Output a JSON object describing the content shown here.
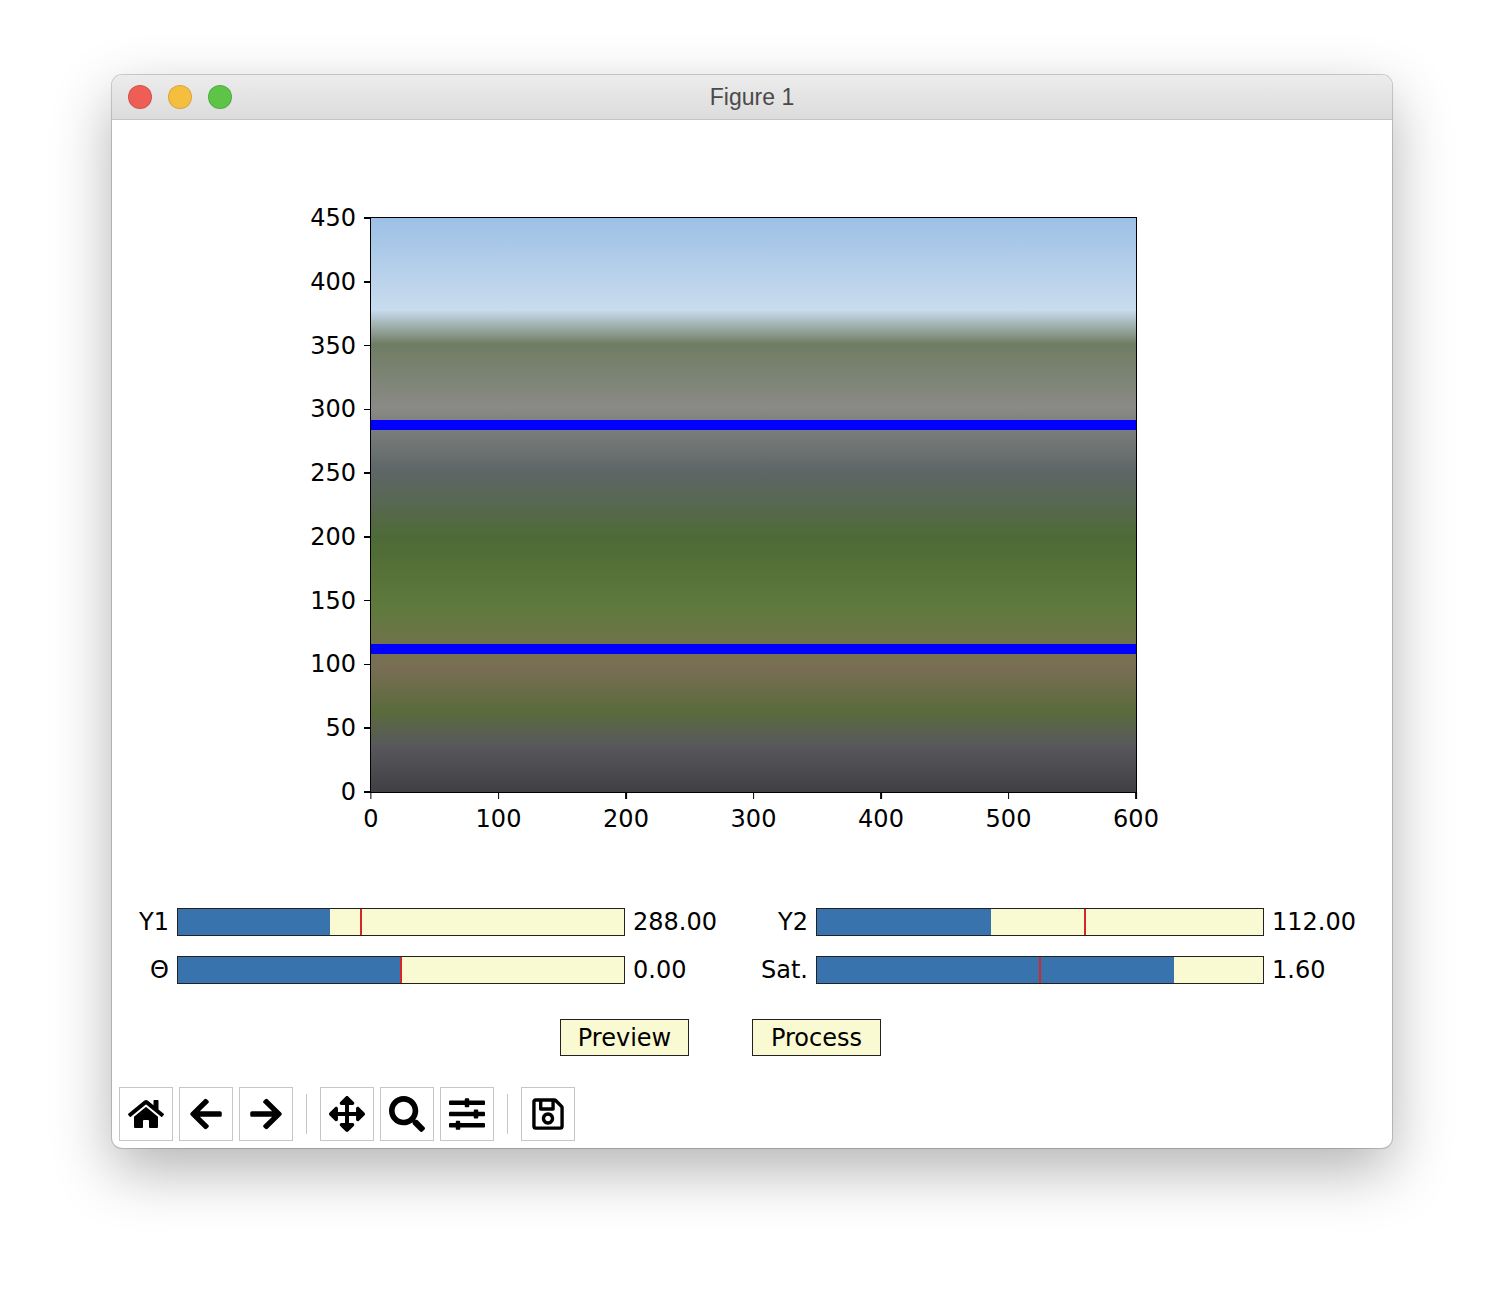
{
  "window": {
    "title": "Figure 1"
  },
  "plot": {
    "y_ticks": [
      "450",
      "400",
      "350",
      "300",
      "250",
      "200",
      "150",
      "100",
      "50",
      "0"
    ],
    "x_ticks": [
      "0",
      "100",
      "200",
      "300",
      "400",
      "500",
      "600"
    ],
    "y_range": [
      0,
      450
    ],
    "x_range": [
      0,
      600
    ],
    "hlines": [
      288,
      112
    ]
  },
  "sliders": [
    {
      "label": "Y1",
      "level": 0.34,
      "marker": 0.41,
      "reading": "288.00"
    },
    {
      "label": "Y2",
      "level": 0.39,
      "marker": 0.6,
      "reading": "112.00"
    },
    {
      "label": "Θ",
      "level": 0.5,
      "marker": 0.5,
      "reading": "0.00"
    },
    {
      "label": "Sat.",
      "level": 0.8,
      "marker": 0.5,
      "reading": "1.60"
    }
  ],
  "buttons": [
    {
      "label": "Preview"
    },
    {
      "label": "Process"
    }
  ]
}
